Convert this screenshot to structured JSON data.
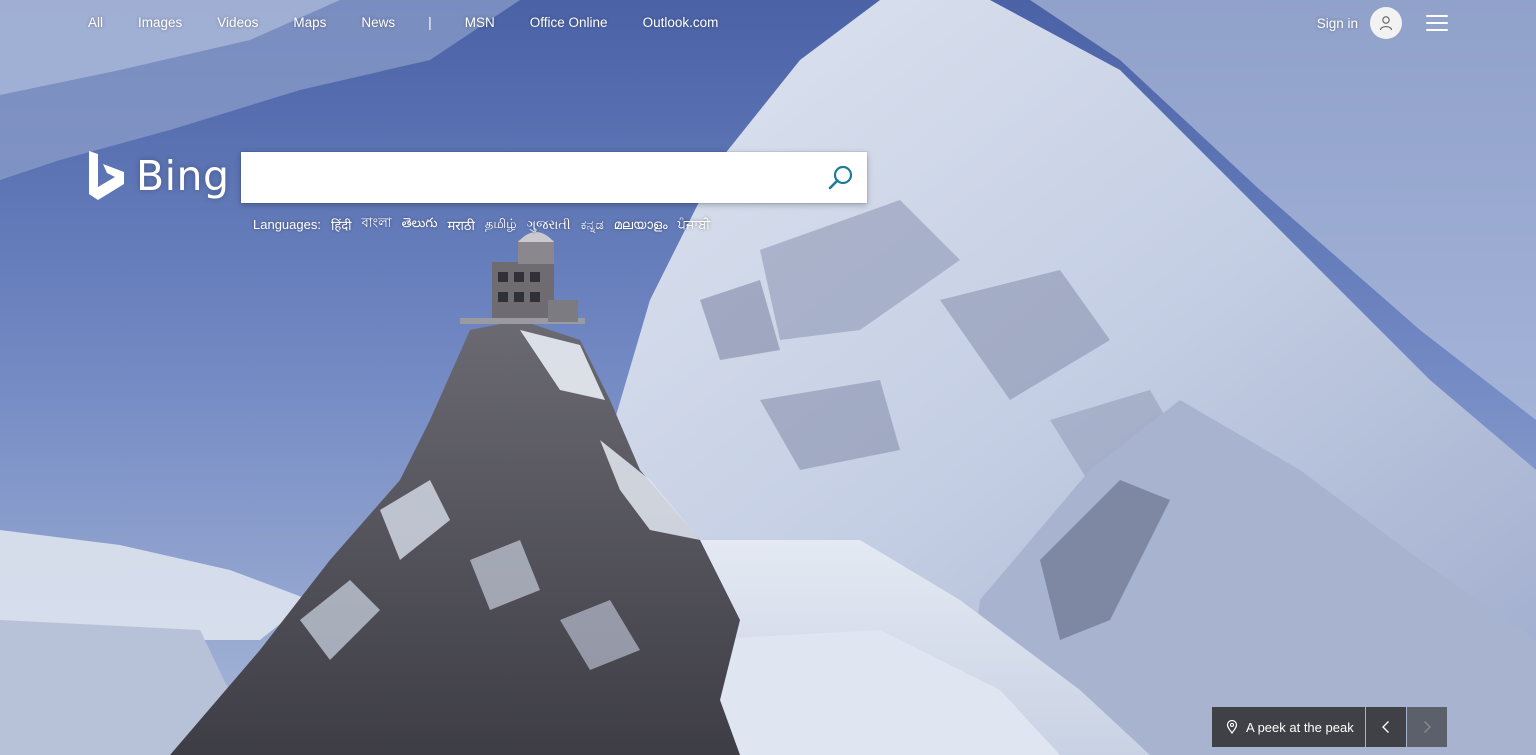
{
  "nav": {
    "links": [
      "All",
      "Images",
      "Videos",
      "Maps",
      "News"
    ],
    "separator": "|",
    "ms_links": [
      "MSN",
      "Office Online",
      "Outlook.com"
    ]
  },
  "account": {
    "signin_label": "Sign in"
  },
  "logo": {
    "word": "Bing"
  },
  "search": {
    "query": ""
  },
  "languages": {
    "label": "Languages:",
    "items": [
      "हिंदी",
      "বাংলা",
      "తెలుగు",
      "मराठी",
      "தமிழ்",
      "ગુજરાતી",
      "ಕನ್ನಡ",
      "മലയാളം",
      "ਪੰਜਾਬੀ"
    ]
  },
  "image_caption": {
    "title": "A peek at the peak"
  },
  "colors": {
    "search_icon": "#1f7b96",
    "caption_bg": "#282828"
  }
}
